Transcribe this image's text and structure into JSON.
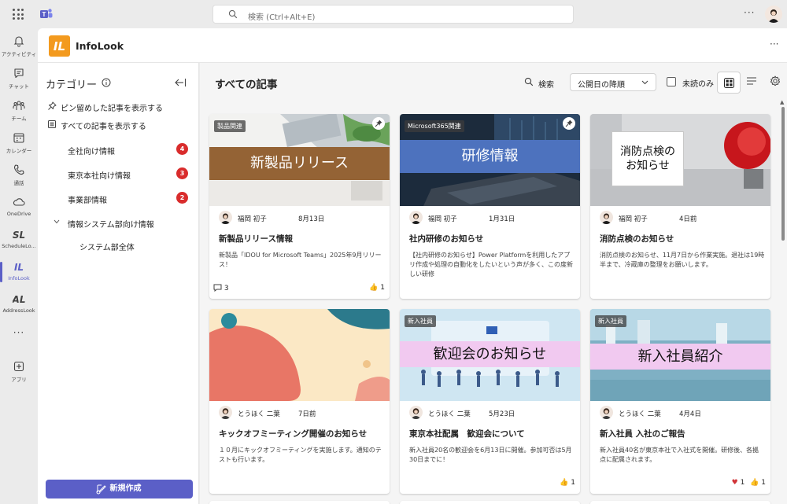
{
  "topbar": {
    "search_placeholder": "検索 (Ctrl+Alt+E)",
    "more": "···"
  },
  "rail": [
    {
      "label": "アクティビティ",
      "icon": "bell-icon"
    },
    {
      "label": "チャット",
      "icon": "chat-icon"
    },
    {
      "label": "チーム",
      "icon": "teams-icon"
    },
    {
      "label": "カレンダー",
      "icon": "calendar-icon"
    },
    {
      "label": "通話",
      "icon": "phone-icon"
    },
    {
      "label": "OneDrive",
      "icon": "cloud-icon"
    },
    {
      "label": "ScheduleLo...",
      "icon": "schedulelook-icon"
    },
    {
      "label": "InfoLook",
      "icon": "infolook-icon"
    },
    {
      "label": "AddressLook",
      "icon": "addresslook-icon"
    },
    {
      "label": "アプリ",
      "icon": "add-apps-icon"
    }
  ],
  "app": {
    "name": "InfoLook",
    "more": "···"
  },
  "sidebar": {
    "title": "カテゴリー",
    "pinned_link": "ピン留めした記事を表示する",
    "all_link": "すべての記事を表示する",
    "categories": [
      {
        "label": "全社向け情報",
        "badge": "4"
      },
      {
        "label": "東京本社向け情報",
        "badge": "3"
      },
      {
        "label": "事業部情報",
        "badge": "2"
      },
      {
        "label": "情報システム部向け情報",
        "badge": ""
      },
      {
        "label": "システム部全体",
        "badge": ""
      }
    ],
    "new_button": "新規作成"
  },
  "main": {
    "title": "すべての記事",
    "search_label": "検索",
    "sort_value": "公開日の降順",
    "unread_label": "未読のみ"
  },
  "cards": [
    {
      "tag": "製品関連",
      "banner": "新製品リリース",
      "author": "福岡 初子",
      "date": "8月13日",
      "title": "新製品リリース情報",
      "desc": "新製品「IDOU for Microsoft Teams」2025年9月リリース！",
      "comments": "3",
      "likes": "1",
      "pinned": true
    },
    {
      "tag": "Microsoft365関連",
      "banner": "研修情報",
      "author": "福岡 初子",
      "date": "1月31日",
      "title": "社内研修のお知らせ",
      "desc": "【社内研修のお知らせ】Power Platformを利用したアプリ作成や処理の自動化をしたいという声が多く、この度新しい研修",
      "comments": "",
      "likes": "",
      "pinned": true
    },
    {
      "tag": "",
      "banner": "消防点検の\nお知らせ",
      "author": "福岡 初子",
      "date": "4日前",
      "title": "消防点検のお知らせ",
      "desc": "消防点検のお知らせ、11月7日から作業実施。退社は19時半まで、冷蔵庫の整理をお願いします。",
      "comments": "",
      "likes": "",
      "pinned": false
    },
    {
      "tag": "",
      "banner": "",
      "author": "とうほく 二葉",
      "date": "7日前",
      "title": "キックオフミーティング開催のお知らせ",
      "desc": "１０月にキックオフミーティングを実施します。通知のテストも行います。",
      "comments": "",
      "likes": "",
      "pinned": false
    },
    {
      "tag": "新入社員",
      "banner": "歓迎会のお知らせ",
      "author": "とうほく 二葉",
      "date": "5月23日",
      "title": "東京本社配属　歓迎会について",
      "desc": "新入社員20名の歓迎会を6月13日に開催。参加可否は5月30日までに！",
      "comments": "",
      "likes": "1",
      "pinned": false
    },
    {
      "tag": "新入社員",
      "banner": "新入社員紹介",
      "author": "とうほく 二葉",
      "date": "4月4日",
      "title": "新入社員 入社のご報告",
      "desc": "新入社員40名が東京本社で入社式を開催。研修後、各拠点に配属されます。",
      "comments": "",
      "likes": "1",
      "hearts": "1",
      "pinned": false
    }
  ],
  "colors": {
    "accent": "#5b5fc7",
    "badge": "#d92c2c",
    "infolook_orange": "#f39a1e"
  }
}
